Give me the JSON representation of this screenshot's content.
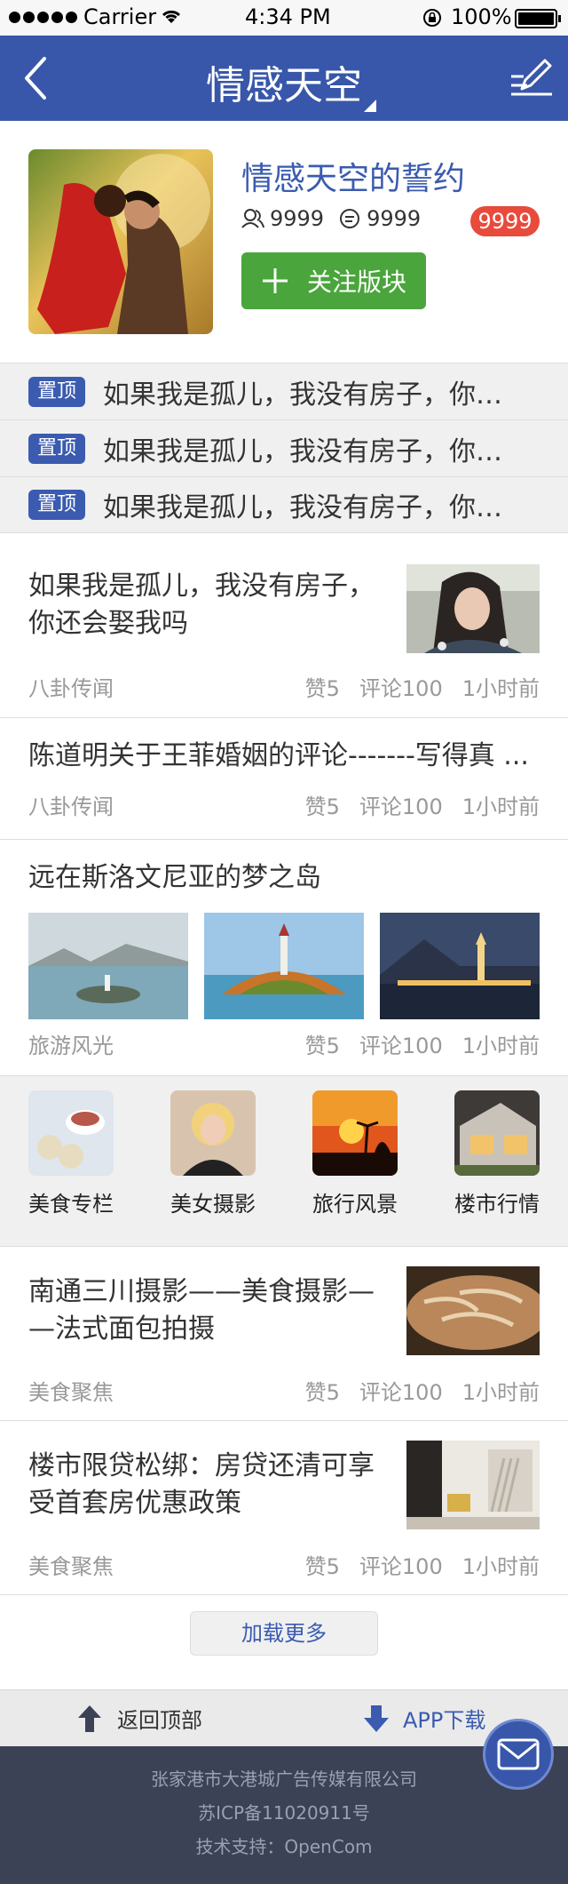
{
  "status_bar": {
    "carrier": "Carrier",
    "time": "4:34 PM",
    "battery": "100%"
  },
  "nav": {
    "title": "情感天空",
    "back_icon": "chevron-left-icon",
    "edit_icon": "compose-icon",
    "bar_color": "#3857aa"
  },
  "board": {
    "name": "情感天空的誓约",
    "members": "9999",
    "posts": "9999",
    "badge": "9999",
    "follow_label": "关注版块"
  },
  "pinned": [
    {
      "tag": "置顶",
      "text": "如果我是孤儿，我没有房子，你还会娶我吗"
    },
    {
      "tag": "置顶",
      "text": "如果我是孤儿，我没有房子，你还会娶我吗"
    },
    {
      "tag": "置顶",
      "text": "如果我是孤儿，我没有房子，你还会娶我吗"
    }
  ],
  "articles": [
    {
      "title_lines": [
        "如果我是孤儿，我没有房子，",
        "你还会娶我吗"
      ],
      "source": "八卦传闻",
      "likes": "赞5",
      "comments": "评论100",
      "time": "1小时前"
    },
    {
      "title_lines": [
        "陈道明关于王菲婚姻的评论-------写得真 ..."
      ],
      "source": "八卦传闻",
      "likes": "赞5",
      "comments": "评论100",
      "time": "1小时前"
    },
    {
      "title_lines": [
        "远在斯洛文尼亚的梦之岛"
      ],
      "source": "旅游风光",
      "likes": "赞5",
      "comments": "评论100",
      "time": "1小时前"
    },
    {
      "title_lines": [
        "南通三川摄影——美食摄影—",
        "—法式面包拍摄"
      ],
      "source": "美食聚焦",
      "likes": "赞5",
      "comments": "评论100",
      "time": "1小时前"
    },
    {
      "title_lines": [
        "楼市限贷松绑：房贷还清可享",
        "受首套房优惠政策"
      ],
      "source": "美食聚焦",
      "likes": "赞5",
      "comments": "评论100",
      "time": "1小时前"
    }
  ],
  "categories": [
    {
      "label": "美食专栏"
    },
    {
      "label": "美女摄影"
    },
    {
      "label": "旅行风景"
    },
    {
      "label": "楼市行情"
    }
  ],
  "load_more": "加载更多",
  "bottom": {
    "back_top": "返回顶部",
    "app_download": "APP下载"
  },
  "footer": {
    "company": "张家港市大港城广告传媒有限公司",
    "icp": "苏ICP备11020911号",
    "support": "技术支持：OpenCom"
  },
  "colors": {
    "accent": "#3a5baf",
    "follow": "#4aa53c",
    "badge": "#e84a3c",
    "footer_bg": "#3b4256"
  }
}
